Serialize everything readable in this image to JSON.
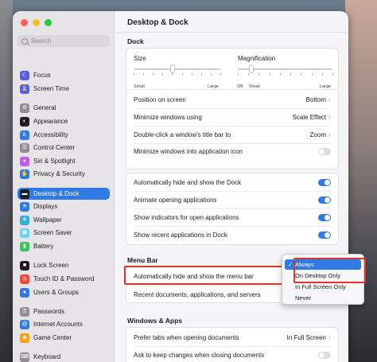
{
  "search": {
    "placeholder": "Search"
  },
  "sidebar": {
    "items": [
      {
        "label": "Focus",
        "icon": "moon-icon",
        "color": "#5e5ce6"
      },
      {
        "label": "Screen Time",
        "icon": "hourglass-icon",
        "color": "#5e5ce6"
      },
      {
        "label": "General",
        "icon": "gear-icon",
        "color": "#8e8e93"
      },
      {
        "label": "Appearance",
        "icon": "appearance-icon",
        "color": "#1d1d1f"
      },
      {
        "label": "Accessibility",
        "icon": "accessibility-icon",
        "color": "#2f7ae5"
      },
      {
        "label": "Control Center",
        "icon": "control-center-icon",
        "color": "#8e8e93"
      },
      {
        "label": "Siri & Spotlight",
        "icon": "siri-icon",
        "color": "#bf5af2"
      },
      {
        "label": "Privacy & Security",
        "icon": "hand-icon",
        "color": "#2f7ae5"
      },
      {
        "label": "Desktop & Dock",
        "icon": "dock-icon",
        "color": "#1d1d1f"
      },
      {
        "label": "Displays",
        "icon": "display-icon",
        "color": "#2f7ae5"
      },
      {
        "label": "Wallpaper",
        "icon": "wallpaper-icon",
        "color": "#32ade6"
      },
      {
        "label": "Screen Saver",
        "icon": "screen-saver-icon",
        "color": "#64d2ff"
      },
      {
        "label": "Battery",
        "icon": "battery-icon",
        "color": "#34c759"
      },
      {
        "label": "Lock Screen",
        "icon": "lock-icon",
        "color": "#1d1d1f"
      },
      {
        "label": "Touch ID & Password",
        "icon": "fingerprint-icon",
        "color": "#ff453a"
      },
      {
        "label": "Users & Groups",
        "icon": "users-icon",
        "color": "#2f7ae5"
      },
      {
        "label": "Passwords",
        "icon": "key-icon",
        "color": "#8e8e93"
      },
      {
        "label": "Internet Accounts",
        "icon": "at-icon",
        "color": "#2f7ae5"
      },
      {
        "label": "Game Center",
        "icon": "game-center-icon",
        "color": "#ff9f0a"
      },
      {
        "label": "Keyboard",
        "icon": "keyboard-icon",
        "color": "#8e8e93"
      }
    ],
    "selected_index": 8
  },
  "main": {
    "title": "Desktop & Dock",
    "dock_section": "Dock",
    "size_label": "Size",
    "size_small": "Small",
    "size_large": "Large",
    "size_value": 0.45,
    "magnification_label": "Magnification",
    "mag_off": "Off",
    "mag_small": "Small",
    "mag_large": "Large",
    "mag_value": 0.02,
    "position_label": "Position on screen",
    "position_value": "Bottom",
    "minimize_label": "Minimize windows using",
    "minimize_value": "Scale Effect",
    "double_click_label": "Double-click a window's title bar to",
    "double_click_value": "Zoom",
    "minimize_icon_label": "Minimize windows into application icon",
    "minimize_icon_on": false,
    "auto_hide_dock_label": "Automatically hide and show the Dock",
    "auto_hide_dock_on": true,
    "animate_label": "Animate opening applications",
    "animate_on": true,
    "indicators_label": "Show indicators for open applications",
    "indicators_on": true,
    "recent_label": "Show recent applications in Dock",
    "recent_on": true,
    "menubar_section": "Menu Bar",
    "auto_hide_menu_label": "Automatically hide and show the menu bar",
    "recent_docs_label": "Recent documents, applications, and servers",
    "windows_section": "Windows & Apps",
    "prefer_tabs_label": "Prefer tabs when opening documents",
    "prefer_tabs_value": "In Full Screen",
    "ask_keep_label": "Ask to keep changes when closing documents",
    "ask_keep_on": false
  },
  "menu": {
    "items": [
      "Always",
      "On Desktop Only",
      "In Full Screen Only",
      "Never"
    ],
    "selected_index": 0
  },
  "colors": {
    "accent": "#2f7ae5",
    "highlight": "#e0352b"
  }
}
